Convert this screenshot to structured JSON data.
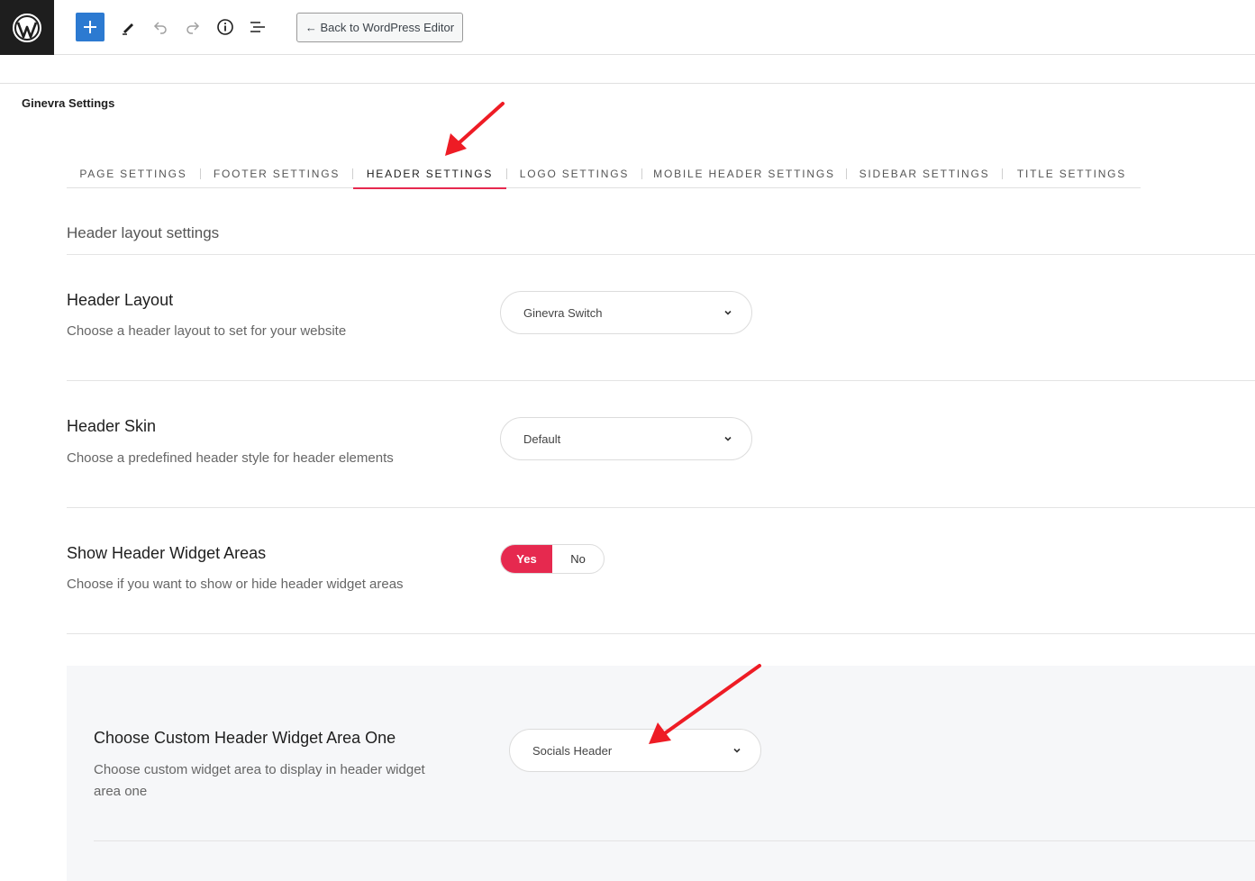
{
  "toolbar": {
    "back_label": "← Back to WordPress Editor",
    "icons": [
      "wordpress-logo",
      "plus-icon",
      "pencil-icon",
      "undo-icon",
      "redo-icon",
      "info-icon",
      "list-view-icon"
    ]
  },
  "page": {
    "heading": "Ginevra Settings"
  },
  "tabs": [
    {
      "label": "PAGE SETTINGS"
    },
    {
      "label": "FOOTER SETTINGS"
    },
    {
      "label": "HEADER SETTINGS",
      "active": true
    },
    {
      "label": "LOGO SETTINGS"
    },
    {
      "label": "MOBILE HEADER SETTINGS"
    },
    {
      "label": "SIDEBAR SETTINGS"
    },
    {
      "label": "TITLE SETTINGS"
    }
  ],
  "section": {
    "title": "Header layout settings"
  },
  "settings": {
    "header_layout": {
      "label": "Header Layout",
      "description": "Choose a header layout to set for your website",
      "value": "Ginevra Switch"
    },
    "header_skin": {
      "label": "Header Skin",
      "description": "Choose a predefined header style for header elements",
      "value": "Default"
    },
    "show_widget_areas": {
      "label": "Show Header Widget Areas",
      "description": "Choose if you want to show or hide header widget areas",
      "yes": "Yes",
      "no": "No",
      "selected": "Yes"
    },
    "widget_area_one": {
      "label": "Choose Custom Header Widget Area One",
      "description": "Choose custom widget area to display in header widget area one",
      "value": "Socials Header"
    }
  },
  "colors": {
    "accent": "#e6294f",
    "wp_button_blue": "#2c7ad1",
    "annotation_arrow": "#ee1c25"
  }
}
